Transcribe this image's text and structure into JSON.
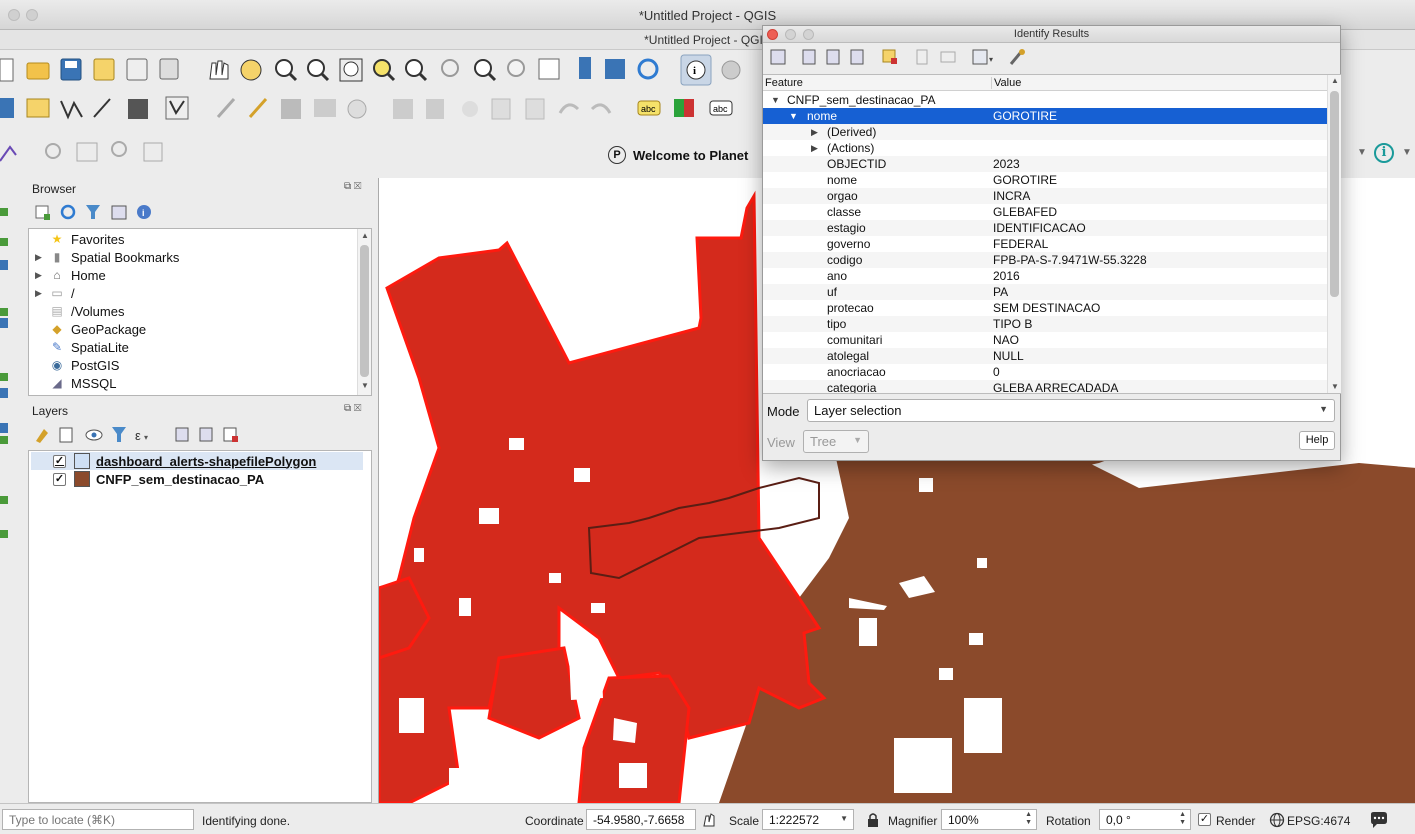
{
  "window": {
    "title": "*Untitled Project - QGIS",
    "subtitle": "*Untitled Project - QGIS"
  },
  "toolbar": {
    "welcome_label": "Welcome to Planet",
    "planet_icon_label": "P"
  },
  "browser": {
    "title": "Browser",
    "items": [
      {
        "label": "Favorites",
        "icon": "star-icon",
        "expandable": false
      },
      {
        "label": "Spatial Bookmarks",
        "icon": "bookmark-icon",
        "expandable": true
      },
      {
        "label": "Home",
        "icon": "home-icon",
        "expandable": true
      },
      {
        "label": "/",
        "icon": "folder-icon",
        "expandable": true
      },
      {
        "label": "/Volumes",
        "icon": "volume-icon",
        "expandable": false
      },
      {
        "label": "GeoPackage",
        "icon": "geopackage-icon",
        "expandable": false
      },
      {
        "label": "SpatiaLite",
        "icon": "spatialite-icon",
        "expandable": false
      },
      {
        "label": "PostGIS",
        "icon": "postgis-icon",
        "expandable": false
      },
      {
        "label": "MSSQL",
        "icon": "mssql-icon",
        "expandable": false
      }
    ]
  },
  "layers": {
    "title": "Layers",
    "items": [
      {
        "label": "dashboard_alerts-shapefilePolygon",
        "checked": true,
        "swatch": "#cfe0f5"
      },
      {
        "label": "CNFP_sem_destinacao_PA",
        "checked": true,
        "swatch": "#8b4a2b"
      }
    ]
  },
  "identify": {
    "title": "Identify Results",
    "col_feature": "Feature",
    "col_value": "Value",
    "layer_name": "CNFP_sem_destinacao_PA",
    "selected": {
      "key": "nome",
      "value": "GOROTIRE"
    },
    "groups": [
      "(Derived)",
      "(Actions)"
    ],
    "attributes": [
      {
        "key": "OBJECTID",
        "value": "2023",
        "highlight": false
      },
      {
        "key": "nome",
        "value": "GOROTIRE",
        "highlight": false
      },
      {
        "key": "orgao",
        "value": "INCRA",
        "highlight": false
      },
      {
        "key": "classe",
        "value": "GLEBAFED",
        "highlight": true
      },
      {
        "key": "estagio",
        "value": "IDENTIFICACAO",
        "highlight": false
      },
      {
        "key": "governo",
        "value": "FEDERAL",
        "highlight": true
      },
      {
        "key": "codigo",
        "value": "FPB-PA-S-7.9471W-55.3228",
        "highlight": false
      },
      {
        "key": "ano",
        "value": "2016",
        "highlight": false
      },
      {
        "key": "uf",
        "value": "PA",
        "highlight": false
      },
      {
        "key": "protecao",
        "value": "SEM DESTINACAO",
        "highlight": true
      },
      {
        "key": "tipo",
        "value": "TIPO B",
        "highlight": false
      },
      {
        "key": "comunitari",
        "value": "NAO",
        "highlight": false
      },
      {
        "key": "atolegal",
        "value": "NULL",
        "highlight": false
      },
      {
        "key": "anocriacao",
        "value": "0",
        "highlight": false
      },
      {
        "key": "categoria",
        "value": "GLEBA ARRECADADA",
        "highlight": false
      }
    ],
    "mode_label": "Mode",
    "mode_value": "Layer selection",
    "view_label": "View",
    "view_value": "Tree",
    "help_label": "Help"
  },
  "status": {
    "locate_placeholder": "Type to locate (⌘K)",
    "message": "Identifying done.",
    "coordinate_label": "Coordinate",
    "coordinate_value": "-54.9580,-7.6658",
    "scale_label": "Scale",
    "scale_value": "1:222572",
    "magnifier_label": "Magnifier",
    "magnifier_value": "100%",
    "rotation_label": "Rotation",
    "rotation_value": "0,0 °",
    "render_label": "Render",
    "render_checked": true,
    "crs_label": "EPSG:4674"
  },
  "colors": {
    "alert_fill": "#d42a1c",
    "alert_stroke": "#ff1a0f",
    "cnfp_fill": "#8b4a2b",
    "selection": "#1660d3",
    "highlight_underline": "#f5ea2a"
  }
}
